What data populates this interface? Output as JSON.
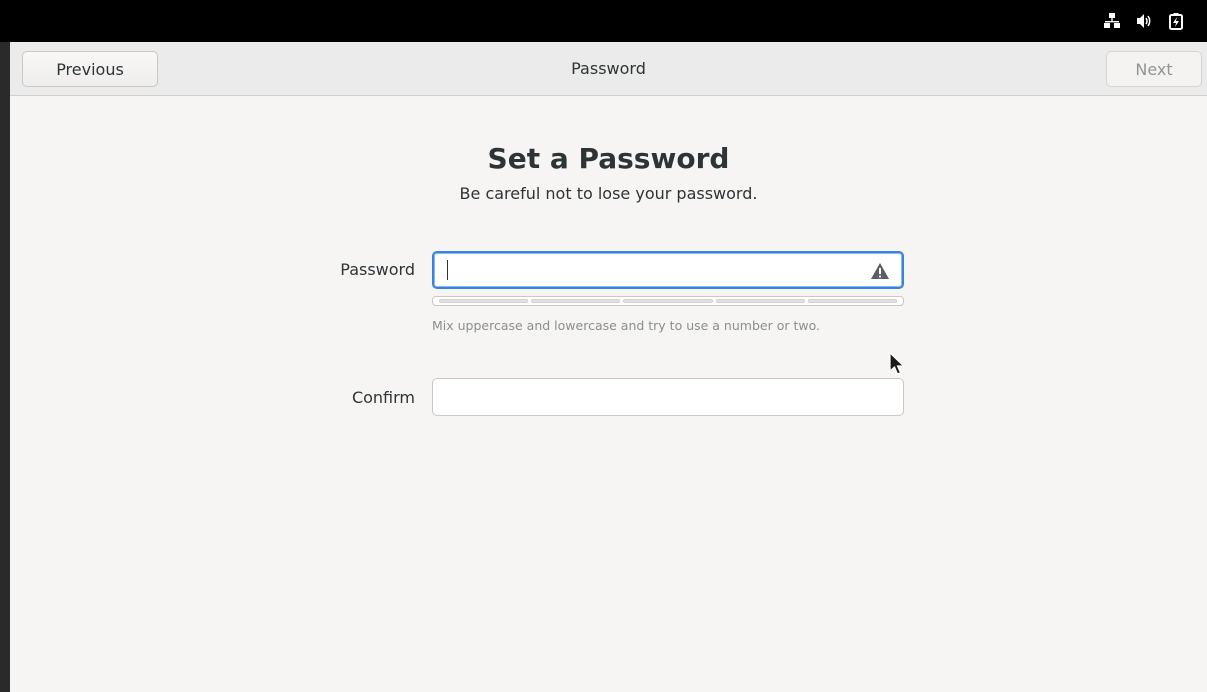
{
  "system_tray": {
    "icons": [
      "network-wired-icon",
      "volume-icon",
      "battery-charging-icon"
    ]
  },
  "headerbar": {
    "previous_label": "Previous",
    "title": "Password",
    "next_label": "Next"
  },
  "page": {
    "title": "Set a Password",
    "subtitle": "Be careful not to lose your password."
  },
  "form": {
    "password_label": "Password",
    "password_value": "",
    "strength_hint": "Mix uppercase and lowercase and try to use a number or two.",
    "strength_segments": 5,
    "confirm_label": "Confirm",
    "confirm_value": ""
  },
  "colors": {
    "accent": "#3584e4",
    "window_bg": "#f6f5f4",
    "text": "#2e3436"
  }
}
